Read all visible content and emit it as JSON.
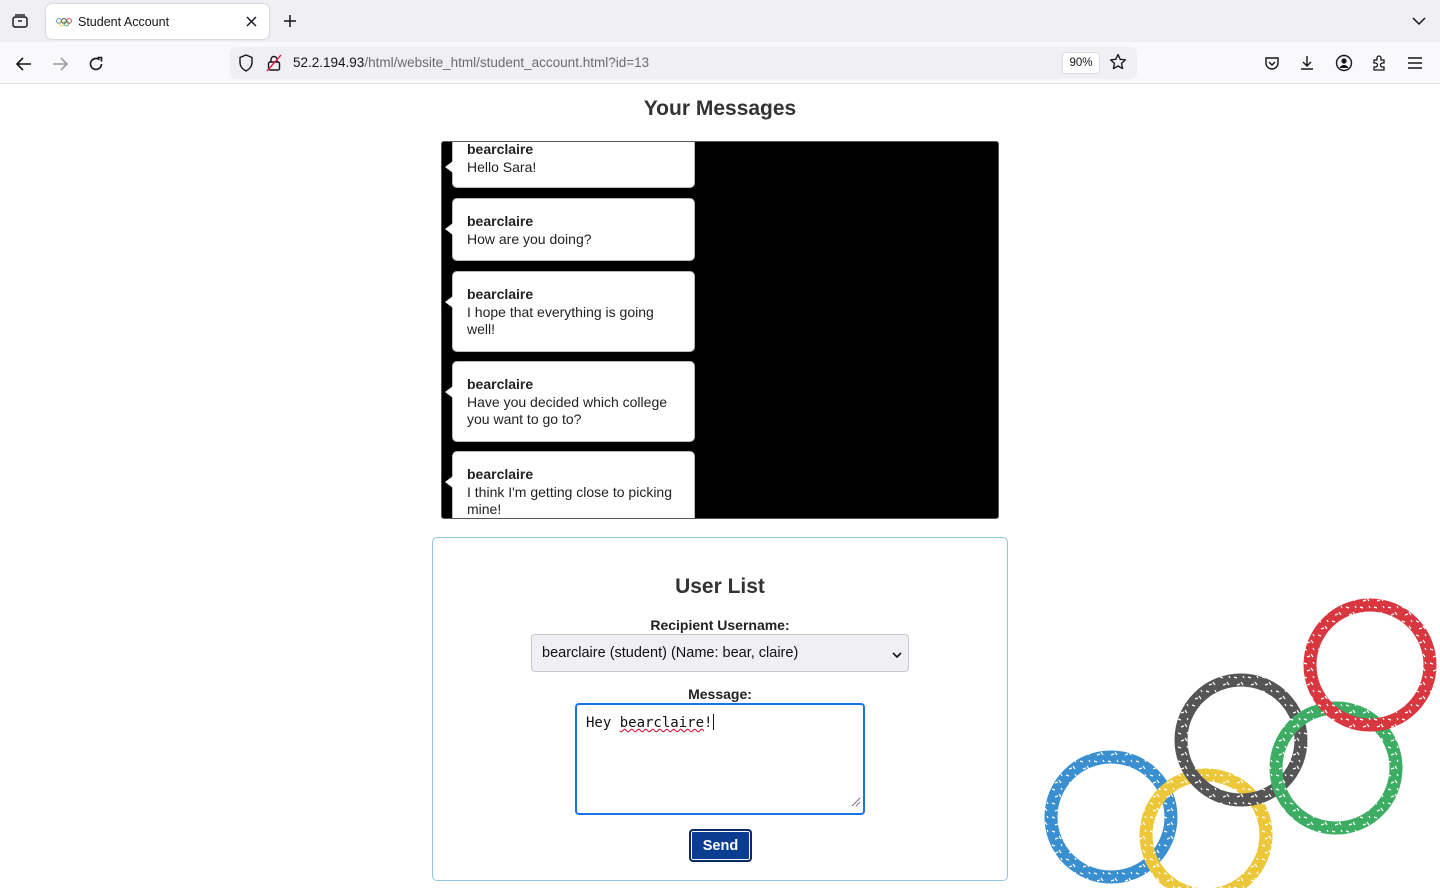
{
  "browser": {
    "tab_title": "Student Account",
    "url_host": "52.2.194.93",
    "url_path": "/html/website_html/student_account.html?id=13",
    "zoom": "90%"
  },
  "page": {
    "title": "Your Messages",
    "messages": [
      {
        "user": "bearclaire",
        "text": "Hello Sara!"
      },
      {
        "user": "bearclaire",
        "text": "How are you doing?"
      },
      {
        "user": "bearclaire",
        "text": "I hope that everything is going well!"
      },
      {
        "user": "bearclaire",
        "text": "Have you decided which college you want to go to?"
      },
      {
        "user": "bearclaire",
        "text": "I think I'm getting close to picking mine!"
      }
    ],
    "user_list": {
      "title": "User List",
      "recipient_label": "Recipient Username:",
      "recipient_selected": "bearclaire (student) (Name: bear, claire)",
      "message_label": "Message:",
      "message_prefix": "Hey ",
      "message_spell": "bearclaire",
      "message_suffix": "!",
      "send_label": "Send"
    }
  },
  "colors": {
    "accent": "#0a3d91",
    "panel_bg": "#000000",
    "rings": [
      "#3a8fd1",
      "#ecc73a",
      "#555555",
      "#3cad63",
      "#d9373f"
    ]
  }
}
